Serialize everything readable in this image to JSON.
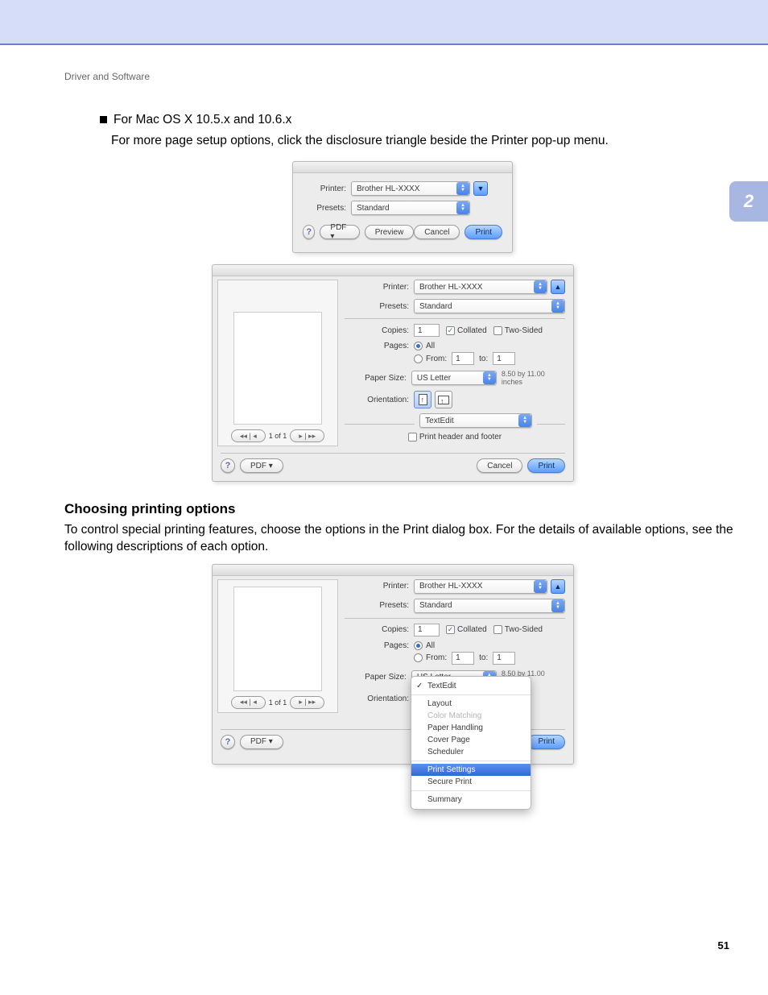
{
  "breadcrumb": "Driver and Software",
  "chapter_number": "2",
  "page_number": "51",
  "intro": {
    "bullet_text": "For Mac OS X 10.5.x and 10.6.x",
    "body_text": "For more page setup options, click the disclosure triangle beside the Printer pop-up menu."
  },
  "dialog_small": {
    "printer_label": "Printer:",
    "printer_value": "Brother HL-XXXX",
    "presets_label": "Presets:",
    "presets_value": "Standard",
    "pdf_label": "PDF ▾",
    "preview_label": "Preview",
    "cancel_label": "Cancel",
    "print_label": "Print"
  },
  "dialog_expanded": {
    "printer_label": "Printer:",
    "printer_value": "Brother HL-XXXX",
    "presets_label": "Presets:",
    "presets_value": "Standard",
    "copies_label": "Copies:",
    "copies_value": "1",
    "collated_label": "Collated",
    "two_sided_label": "Two-Sided",
    "pages_label": "Pages:",
    "all_label": "All",
    "from_label": "From:",
    "from_value": "1",
    "to_label": "to:",
    "to_value": "1",
    "paper_size_label": "Paper Size:",
    "paper_size_value": "US Letter",
    "paper_size_dims": "8.50 by 11.00 inches",
    "orientation_label": "Orientation:",
    "section_value": "TextEdit",
    "print_hf_label": "Print header and footer",
    "pager": "1 of 1",
    "pdf_label": "PDF ▾",
    "cancel_label": "Cancel",
    "print_label": "Print"
  },
  "section2": {
    "heading": "Choosing printing options",
    "body": "To control special printing features, choose the options in the Print dialog box. For the details of available options, see the following descriptions of each option."
  },
  "dialog_menu": {
    "menu_items": {
      "textedit": "TextEdit",
      "layout": "Layout",
      "color_matching": "Color Matching",
      "paper_handling": "Paper Handling",
      "cover_page": "Cover Page",
      "scheduler": "Scheduler",
      "print_settings": "Print Settings",
      "secure_print": "Secure Print",
      "summary": "Summary"
    }
  }
}
